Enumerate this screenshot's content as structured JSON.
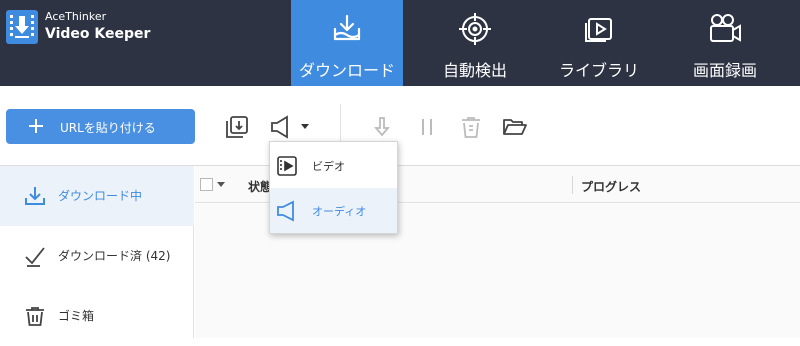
{
  "app": {
    "brand_line1": "AceThinker",
    "brand_line2": "Video Keeper"
  },
  "nav": {
    "tabs": [
      {
        "label": "ダウンロード",
        "icon": "download-tray-icon",
        "active": true
      },
      {
        "label": "自動検出",
        "icon": "target-icon",
        "active": false
      },
      {
        "label": "ライブラリ",
        "icon": "library-play-icon",
        "active": false
      },
      {
        "label": "画面録画",
        "icon": "video-camera-icon",
        "active": false
      }
    ]
  },
  "toolbar": {
    "paste_label": "URLを貼り付ける",
    "tools": [
      "download-copy-icon",
      "audio-format-icon",
      "dropdown-caret-icon",
      "resume-download-icon",
      "pause-icon",
      "delete-icon",
      "open-folder-icon"
    ]
  },
  "dropdown": {
    "items": [
      {
        "label": "ビデオ",
        "icon": "video-file-icon"
      },
      {
        "label": "オーディオ",
        "icon": "speaker-icon",
        "highlighted": true
      }
    ]
  },
  "sidebar": {
    "items": [
      {
        "label": "ダウンロード中",
        "icon": "download-icon",
        "active": true
      },
      {
        "label": "ダウンロード済 (42)",
        "icon": "checked-icon",
        "active": false
      },
      {
        "label": "ゴミ箱",
        "icon": "trash-icon",
        "active": false
      }
    ]
  },
  "table": {
    "columns": [
      "状態",
      "プログレス"
    ]
  },
  "colors": {
    "header_bg": "#2e3344",
    "accent": "#3f8be0",
    "button": "#4a90e2"
  }
}
